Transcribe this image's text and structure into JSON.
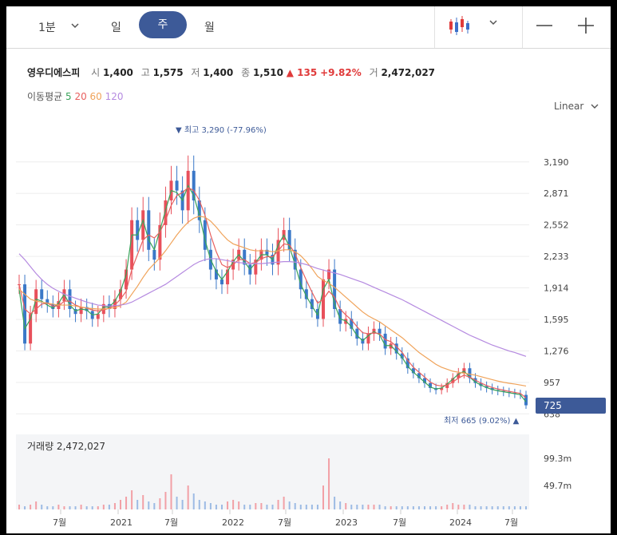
{
  "toolbar": {
    "interval_label": "1분",
    "tab_day": "일",
    "tab_week": "주",
    "tab_month": "월",
    "active_tab": "주",
    "icon_candle": "candlestick-icon",
    "icon_chevron": "chevron-down-icon",
    "icon_zoom_out": "minus-icon",
    "icon_zoom_in": "plus-icon"
  },
  "quote": {
    "name": "영우디에스피",
    "open_label": "시",
    "open": "1,400",
    "high_label": "고",
    "high": "1,575",
    "low_label": "저",
    "low": "1,400",
    "close_label": "종",
    "close": "1,510",
    "change": "▲ 135",
    "change_pct": "+9.82%",
    "volume_label": "거",
    "volume": "2,472,027"
  },
  "moving_average": {
    "label": "이동평균",
    "periods": [
      "5",
      "20",
      "60",
      "120"
    ],
    "colors": [
      "#3aa35a",
      "#e8605f",
      "#f0a35a",
      "#b58ae0"
    ]
  },
  "scale_mode": "Linear",
  "current_price_badge": "725",
  "chart_data": {
    "type": "candlestick",
    "title": "",
    "xlabel": "",
    "ylabel": "",
    "ylim": [
      600,
      3350
    ],
    "y_ticks": [
      "3,190",
      "2,871",
      "2,552",
      "2,233",
      "1,914",
      "1,595",
      "1,276",
      "957",
      "638"
    ],
    "x_ticks": [
      "7월",
      "2021",
      "7월",
      "2022",
      "7월",
      "2023",
      "7월",
      "2024",
      "7월"
    ],
    "high_annotation": "▼ 최고 3,290 (-77.96%)",
    "low_annotation": "최저 665 (9.02%) ▲",
    "grid": true,
    "price_series": [
      {
        "name": "close",
        "values": [
          1950,
          1350,
          1650,
          1900,
          1800,
          1750,
          1700,
          1780,
          1900,
          1700,
          1650,
          1720,
          1680,
          1600,
          1650,
          1750,
          1700,
          1800,
          1900,
          2100,
          2600,
          2400,
          2700,
          2300,
          2200,
          2550,
          2800,
          3000,
          2900,
          2700,
          3100,
          2800,
          2600,
          2300,
          2100,
          2000,
          1950,
          2100,
          2200,
          2300,
          2150,
          2050,
          2200,
          2300,
          2250,
          2150,
          2400,
          2500,
          2300,
          2100,
          1900,
          1800,
          1700,
          1600,
          2000,
          2100,
          1700,
          1550,
          1600,
          1500,
          1400,
          1350,
          1450,
          1500,
          1450,
          1300,
          1350,
          1250,
          1200,
          1100,
          1050,
          1000,
          950,
          900,
          880,
          900,
          950,
          1000,
          1050,
          1100,
          1000,
          950,
          920,
          900,
          880,
          870,
          860,
          850,
          840,
          830,
          725
        ]
      },
      {
        "name": "5",
        "values": [
          1900,
          1500,
          1600,
          1800,
          1780,
          1740,
          1710,
          1760,
          1850,
          1740,
          1680,
          1700,
          1690,
          1640,
          1650,
          1720,
          1720,
          1780,
          1880,
          2050,
          2450,
          2450,
          2600,
          2400,
          2300,
          2500,
          2700,
          2900,
          2880,
          2800,
          2950,
          2850,
          2650,
          2400,
          2200,
          2080,
          2000,
          2080,
          2180,
          2250,
          2180,
          2100,
          2170,
          2250,
          2250,
          2200,
          2350,
          2450,
          2330,
          2150,
          1950,
          1830,
          1730,
          1640,
          1900,
          2000,
          1750,
          1600,
          1580,
          1520,
          1430,
          1380,
          1430,
          1470,
          1440,
          1330,
          1330,
          1270,
          1210,
          1120,
          1060,
          1010,
          960,
          910,
          890,
          900,
          940,
          990,
          1040,
          1070,
          1010,
          960,
          930,
          905,
          885,
          872,
          862,
          852,
          842,
          832,
          760
        ]
      },
      {
        "name": "20",
        "values": [
          1950,
          1700,
          1650,
          1700,
          1750,
          1760,
          1730,
          1730,
          1780,
          1780,
          1740,
          1720,
          1710,
          1690,
          1680,
          1690,
          1710,
          1740,
          1800,
          1880,
          2100,
          2250,
          2400,
          2450,
          2420,
          2480,
          2600,
          2750,
          2850,
          2880,
          2930,
          2900,
          2800,
          2650,
          2450,
          2280,
          2150,
          2120,
          2150,
          2200,
          2200,
          2160,
          2170,
          2210,
          2230,
          2230,
          2290,
          2360,
          2350,
          2260,
          2120,
          1990,
          1870,
          1760,
          1800,
          1880,
          1820,
          1700,
          1640,
          1590,
          1520,
          1460,
          1450,
          1460,
          1450,
          1390,
          1370,
          1320,
          1260,
          1180,
          1110,
          1060,
          1010,
          960,
          930,
          920,
          930,
          960,
          1000,
          1030,
          1010,
          980,
          950,
          925,
          905,
          890,
          878,
          866,
          855,
          845,
          800
        ]
      },
      {
        "name": "60",
        "values": [
          1900,
          1850,
          1800,
          1780,
          1770,
          1760,
          1750,
          1740,
          1740,
          1740,
          1730,
          1720,
          1710,
          1705,
          1700,
          1700,
          1705,
          1715,
          1735,
          1770,
          1850,
          1930,
          2020,
          2100,
          2160,
          2220,
          2290,
          2370,
          2450,
          2520,
          2580,
          2620,
          2640,
          2630,
          2590,
          2530,
          2460,
          2400,
          2360,
          2340,
          2320,
          2300,
          2290,
          2290,
          2290,
          2280,
          2290,
          2300,
          2300,
          2280,
          2240,
          2180,
          2110,
          2030,
          1990,
          1960,
          1920,
          1870,
          1820,
          1770,
          1720,
          1670,
          1630,
          1600,
          1570,
          1530,
          1490,
          1450,
          1410,
          1360,
          1310,
          1260,
          1220,
          1180,
          1140,
          1110,
          1090,
          1070,
          1060,
          1050,
          1040,
          1030,
          1015,
          1000,
          985,
          970,
          958,
          948,
          940,
          930,
          920
        ]
      },
      {
        "name": "120",
        "values": [
          2260,
          2200,
          2130,
          2060,
          2000,
          1950,
          1910,
          1880,
          1850,
          1830,
          1810,
          1790,
          1770,
          1755,
          1740,
          1735,
          1730,
          1735,
          1740,
          1750,
          1770,
          1800,
          1830,
          1860,
          1890,
          1920,
          1950,
          1990,
          2030,
          2070,
          2110,
          2150,
          2180,
          2200,
          2210,
          2210,
          2200,
          2190,
          2180,
          2170,
          2165,
          2160,
          2160,
          2160,
          2165,
          2170,
          2175,
          2180,
          2180,
          2175,
          2165,
          2150,
          2130,
          2110,
          2095,
          2080,
          2065,
          2050,
          2030,
          2010,
          1990,
          1970,
          1945,
          1920,
          1895,
          1870,
          1845,
          1820,
          1795,
          1765,
          1735,
          1705,
          1675,
          1645,
          1615,
          1585,
          1555,
          1525,
          1495,
          1465,
          1435,
          1410,
          1385,
          1360,
          1335,
          1315,
          1295,
          1275,
          1260,
          1240,
          1220
        ]
      }
    ],
    "volume_series": {
      "name": "거래량",
      "y_ticks": [
        "99.3m",
        "49.7m"
      ],
      "label": "거래량 2,472,027",
      "values": [
        3,
        2,
        3,
        5,
        3,
        2,
        2,
        3,
        2,
        2,
        2,
        3,
        2,
        2,
        2,
        3,
        3,
        4,
        6,
        8,
        12,
        6,
        9,
        5,
        4,
        7,
        11,
        22,
        8,
        6,
        15,
        10,
        6,
        5,
        4,
        3,
        3,
        5,
        6,
        5,
        3,
        3,
        4,
        4,
        3,
        3,
        6,
        8,
        5,
        4,
        3,
        3,
        3,
        3,
        15,
        32,
        8,
        5,
        4,
        3,
        3,
        3,
        3,
        3,
        3,
        2,
        2,
        2,
        2,
        2,
        2,
        2,
        2,
        2,
        2,
        2,
        3,
        4,
        3,
        3,
        3,
        2,
        2,
        2,
        2,
        2,
        2,
        2,
        2,
        2,
        2
      ]
    }
  }
}
